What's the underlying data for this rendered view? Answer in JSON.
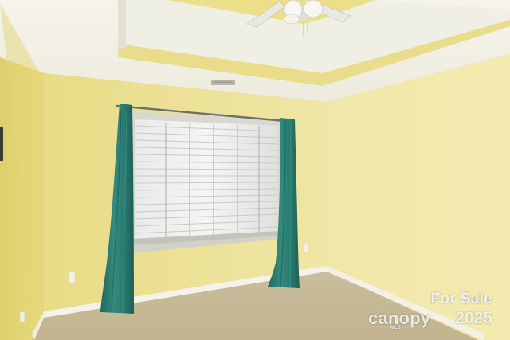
{
  "photo": {
    "subject": "empty-bedroom",
    "colors": {
      "wall_left": "#e8dc7c",
      "wall_back": "#ece29a",
      "wall_right": "#eee4a0",
      "ceiling": "#f3f1e6",
      "tray_trim": "#eadc8a",
      "carpet": "#c9bd9a",
      "curtain": "#2f8378",
      "baseboard": "#f4f2ea"
    }
  },
  "watermark": {
    "line1": "For Sale",
    "brand": "canopy",
    "brand_sub": "MLS",
    "year": "2025"
  }
}
